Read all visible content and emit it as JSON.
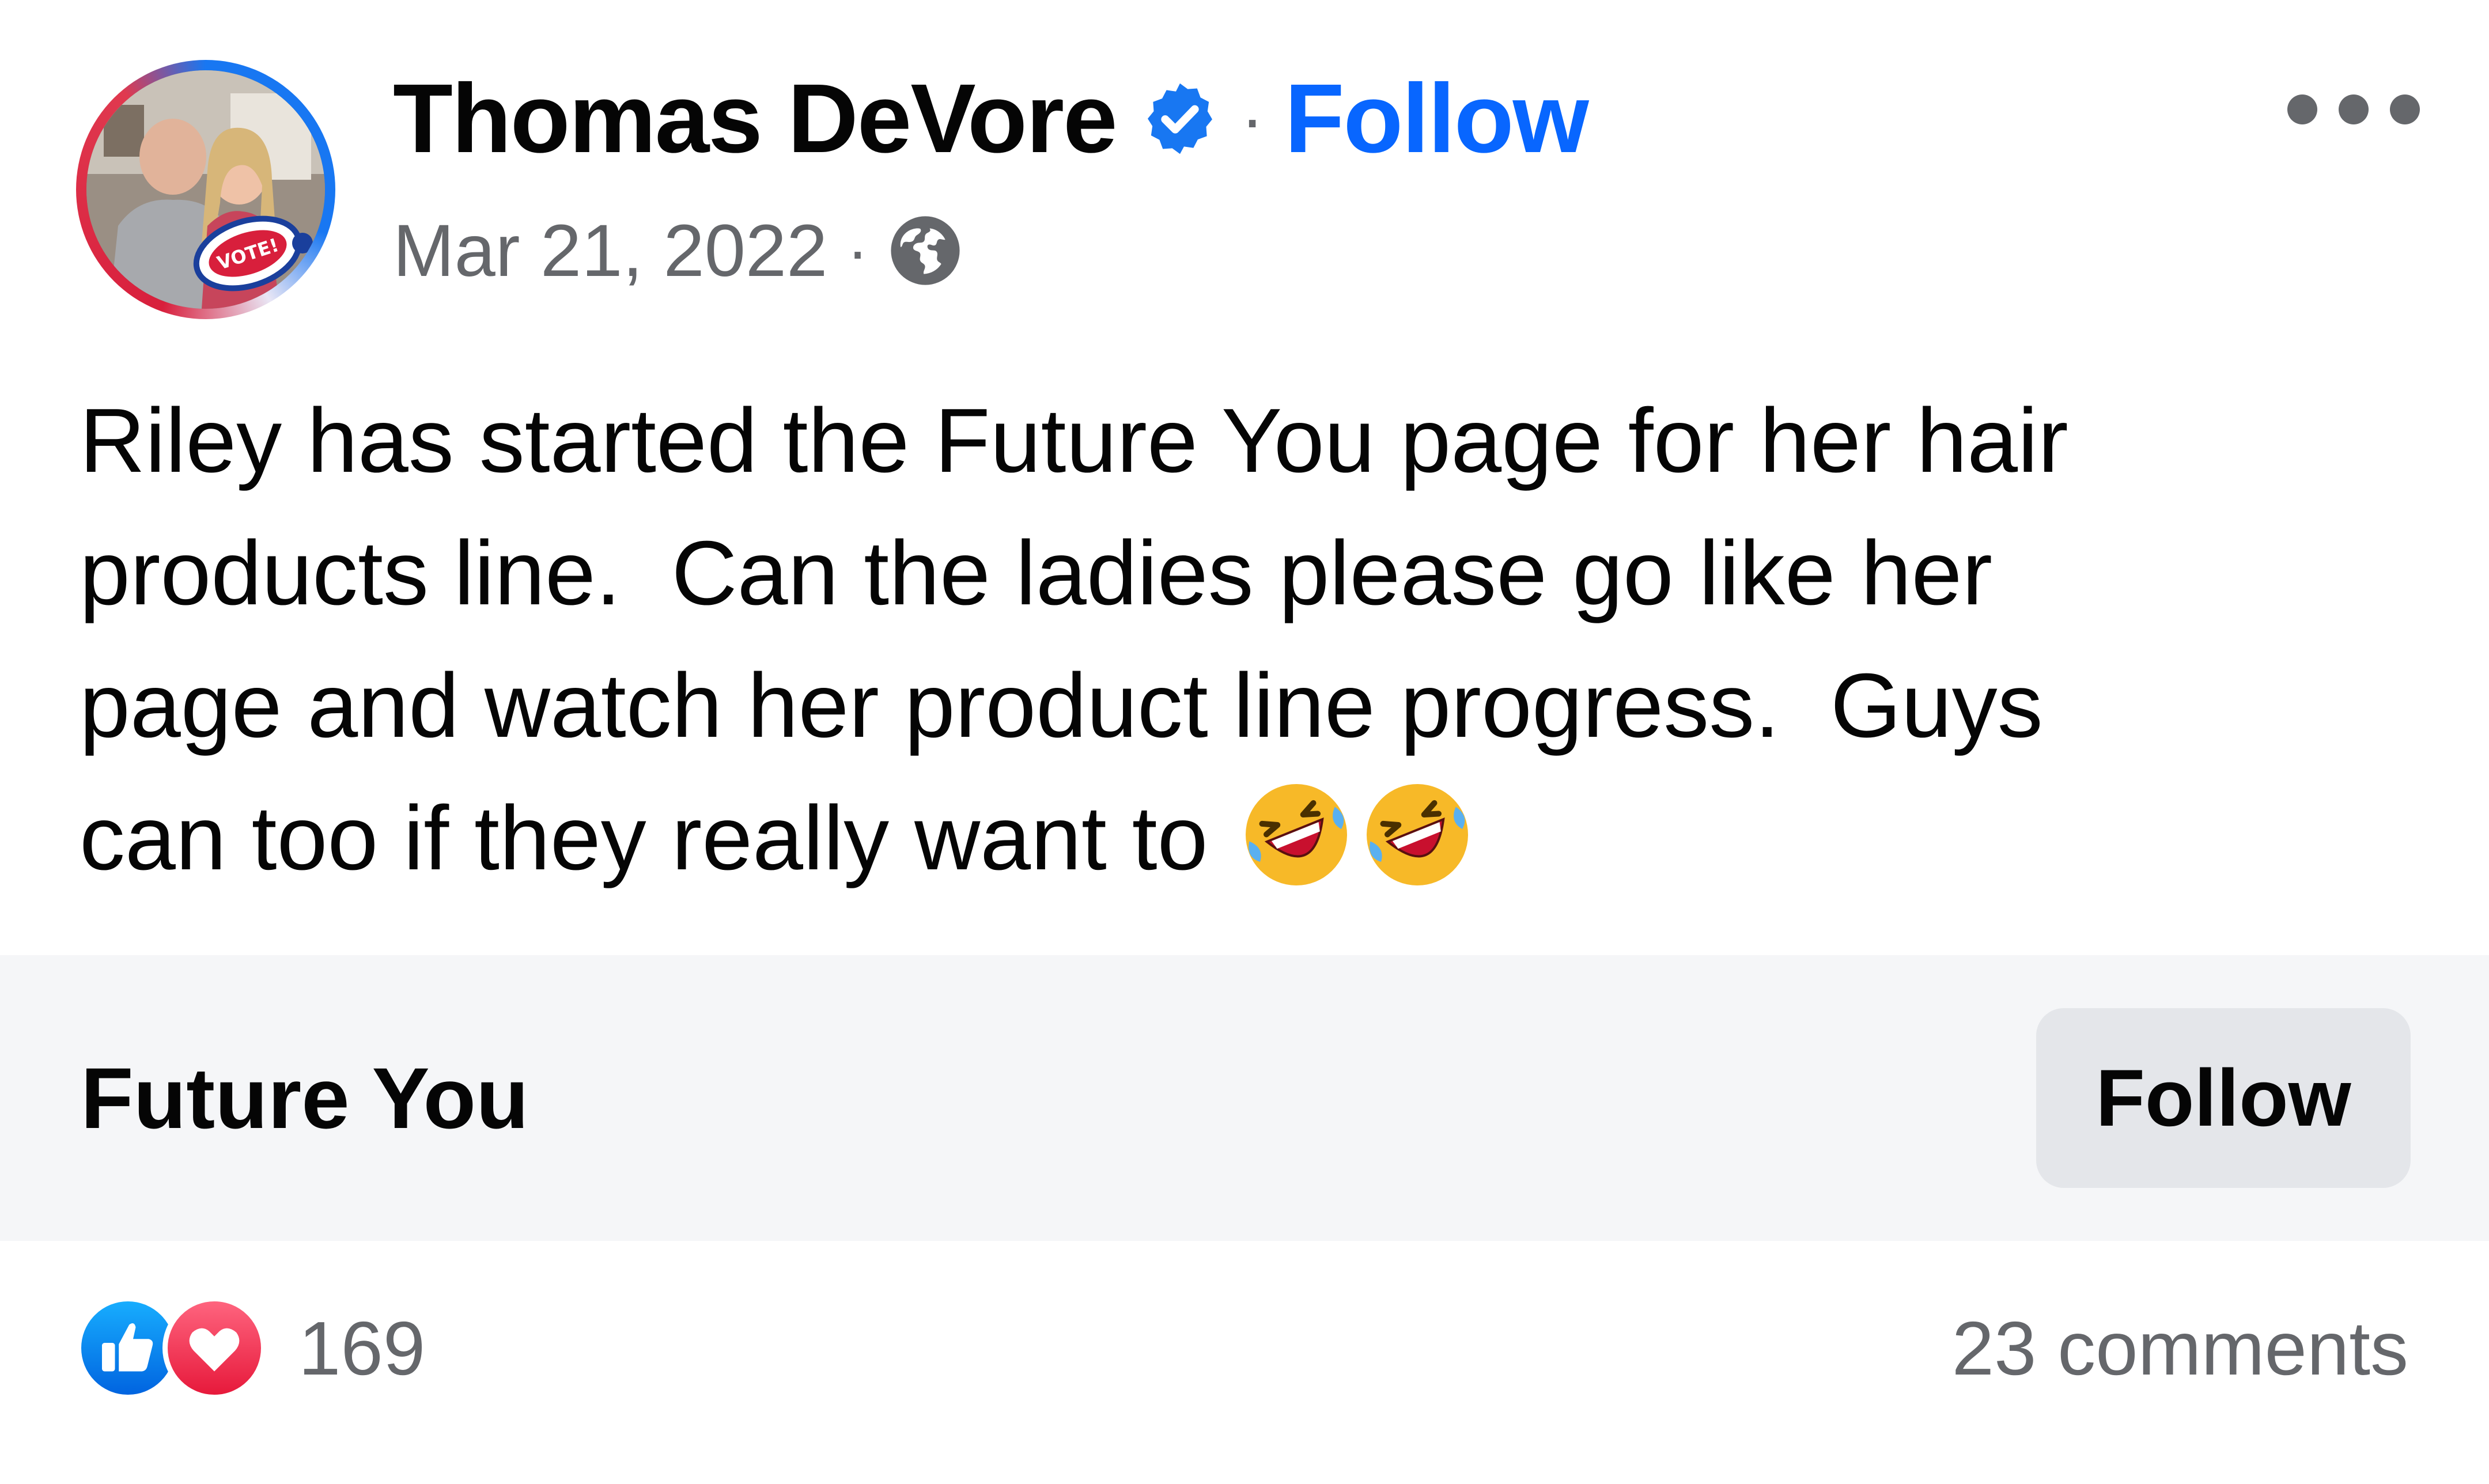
{
  "post": {
    "author": {
      "name": "Thomas DeVore",
      "verified_icon": "verified-badge-icon",
      "follow_label": "Follow",
      "avatar_badge_text": "VOTE!"
    },
    "separator": "·",
    "date": "Mar 21, 2022",
    "audience_icon": "globe-icon",
    "more_icon": "more-options-icon",
    "text_lines": [
      "Riley has started the Future You page for her hair",
      "products line.  Can the ladies please go like her",
      "page and watch her product line progress.  Guys",
      "can too if they really want to"
    ],
    "emojis": [
      "rolling-on-floor-laughing",
      "rolling-on-floor-laughing"
    ]
  },
  "shared_page": {
    "title": "Future You",
    "follow_label": "Follow"
  },
  "footer": {
    "reaction_icons": [
      "like-icon",
      "love-icon"
    ],
    "reaction_count": "169",
    "comments": "23 comments"
  },
  "colors": {
    "link_blue": "#0866ff",
    "secondary_text": "#65676b",
    "card_background": "#f5f6f8",
    "button_background": "#e4e6ea",
    "like_blue": "#1877f2",
    "love_red": "#f02849"
  }
}
